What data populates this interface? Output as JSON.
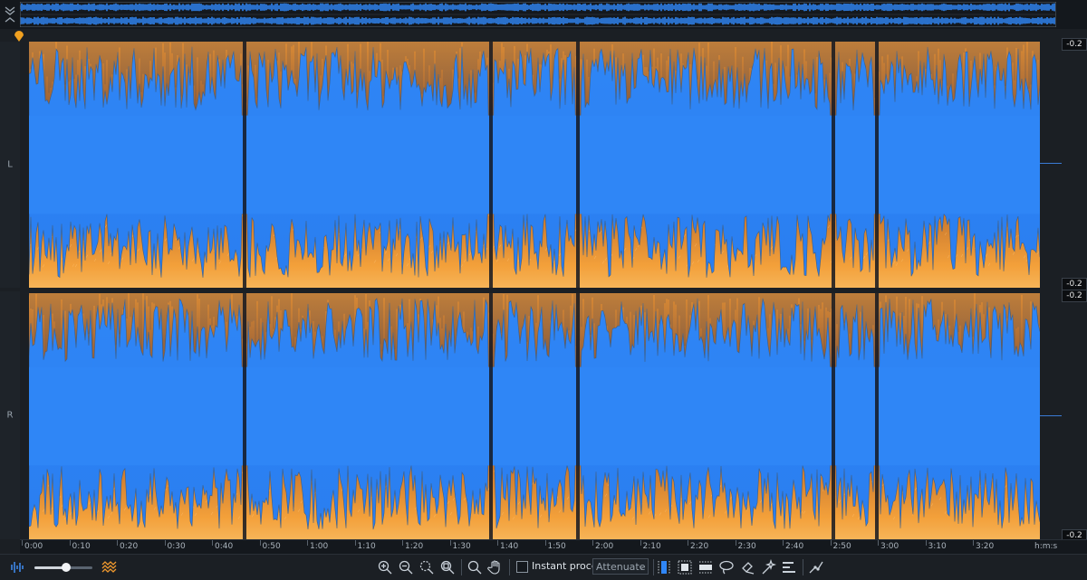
{
  "overview": {
    "collapse_icon": "collapse-chevrons-icon"
  },
  "channels": {
    "left_label": "L",
    "right_label": "R"
  },
  "scale": {
    "left_top_db": "-0.2",
    "left_bottom_db": "-0.2",
    "right_top_db": "-0.2",
    "right_bottom_db": "-0.2"
  },
  "ruler": {
    "ticks": [
      "0:00",
      "0:10",
      "0:20",
      "0:30",
      "0:40",
      "0:50",
      "1:00",
      "1:10",
      "1:20",
      "1:30",
      "1:40",
      "1:50",
      "2:00",
      "2:10",
      "2:20",
      "2:30",
      "2:40",
      "2:50",
      "3:00",
      "3:10",
      "3:20"
    ],
    "unit": "h:m:s"
  },
  "toolbar": {
    "zoom_level": 0.55,
    "instant_process_label": "Instant process",
    "instant_process_checked": false,
    "mode_value": "Attenuate"
  },
  "colors": {
    "waveform": "#2f86f6",
    "spectrogram_hot": "#f29a2e",
    "spectrogram_dark": "#1a2434",
    "playhead": "#f0a020"
  }
}
